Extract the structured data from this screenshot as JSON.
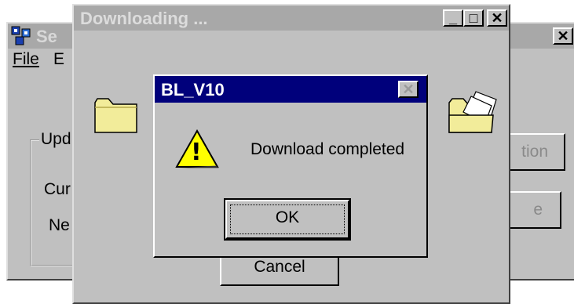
{
  "setup": {
    "title": "Se",
    "menu_file": "File",
    "menu_second": "E",
    "group_label": "Upd",
    "current_label": "Cur",
    "new_label": "Ne",
    "action_button": "tion",
    "second_button": "e",
    "close_glyph": "✕"
  },
  "downloading": {
    "title": "Downloading ...",
    "minimize_glyph": "_",
    "maximize_glyph": "□",
    "close_glyph": "✕",
    "cancel_label": "Cancel"
  },
  "dialog": {
    "title": "BL_V10",
    "close_glyph": "✕",
    "message": "Download completed",
    "ok_label": "OK",
    "warning_glyph": "!"
  },
  "colors": {
    "active_title": "#00007b",
    "face": "#c0c0c0",
    "warning_yellow": "#ffff00",
    "folder_yellow": "#f2ec9a"
  },
  "icons": {
    "app": "setup-app-icon",
    "folder_left": "folder-icon",
    "folder_right": "open-folder-icon",
    "warning": "warning-icon"
  }
}
